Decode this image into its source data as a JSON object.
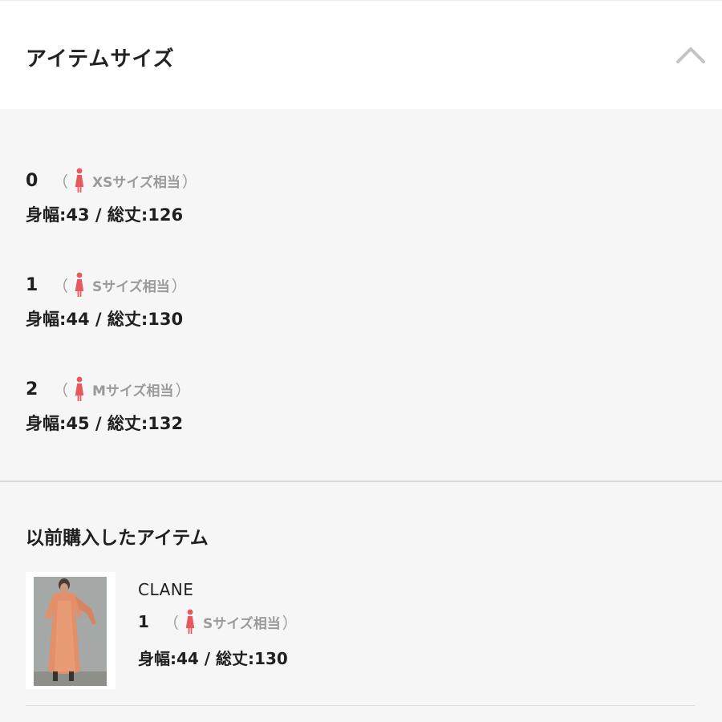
{
  "header": {
    "title": "アイテムサイズ",
    "toggle_icon": "chevron-up-icon"
  },
  "sizes": [
    {
      "size": "0",
      "paren_open": "（",
      "equivalent": "XSサイズ相当",
      "paren_close": "）",
      "measurements": "身幅:43 / 総丈:126"
    },
    {
      "size": "1",
      "paren_open": "（",
      "equivalent": "Sサイズ相当",
      "paren_close": "）",
      "measurements": "身幅:44 / 総丈:130"
    },
    {
      "size": "2",
      "paren_open": "（",
      "equivalent": "Mサイズ相当",
      "paren_close": "）",
      "measurements": "身幅:45 / 総丈:132"
    }
  ],
  "previous": {
    "title": "以前購入したアイテム",
    "item": {
      "brand": "CLANE",
      "size": "1",
      "paren_open": "（",
      "equivalent": "Sサイズ相当",
      "paren_close": "）",
      "measurements": "身幅:44 / 総丈:130"
    }
  },
  "colors": {
    "figure_icon": "#e8585f",
    "muted_text": "#9a9a9a",
    "header_bg": "#ffffff",
    "body_bg": "#f6f6f6"
  }
}
